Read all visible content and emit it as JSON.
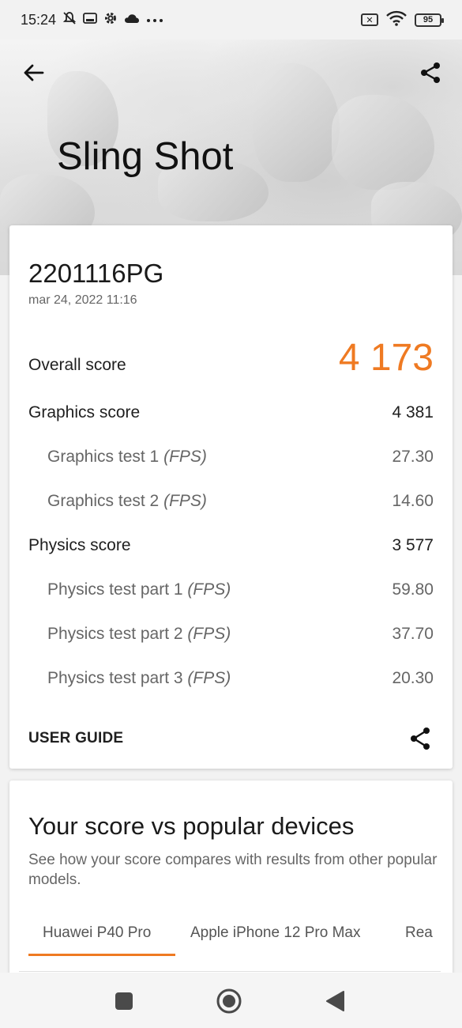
{
  "status_bar": {
    "time": "15:24",
    "battery": "95",
    "icons": [
      "muted-icon",
      "storage-icon",
      "gear-icon",
      "cloud-icon",
      "more-icon",
      "no-sim-icon",
      "wifi-icon",
      "battery-icon"
    ]
  },
  "header": {
    "title": "Sling Shot"
  },
  "result": {
    "device": "2201116PG",
    "date": "mar 24, 2022 11:16",
    "overall": {
      "label": "Overall score",
      "value": "4 173"
    },
    "graphics": {
      "label": "Graphics score",
      "value": "4 381"
    },
    "graphics_test_1": {
      "label": "Graphics test 1",
      "unit": "(FPS)",
      "value": "27.30"
    },
    "graphics_test_2": {
      "label": "Graphics test 2",
      "unit": "(FPS)",
      "value": "14.60"
    },
    "physics": {
      "label": "Physics score",
      "value": "3 577"
    },
    "physics_test_1": {
      "label": "Physics test part 1",
      "unit": "(FPS)",
      "value": "59.80"
    },
    "physics_test_2": {
      "label": "Physics test part 2",
      "unit": "(FPS)",
      "value": "37.70"
    },
    "physics_test_3": {
      "label": "Physics test part 3",
      "unit": "(FPS)",
      "value": "20.30"
    },
    "user_guide": "USER GUIDE"
  },
  "compare": {
    "title": "Your score vs popular devices",
    "description": "See how your score compares with results from other popular models.",
    "tabs": [
      "Huawei P40 Pro",
      "Apple iPhone 12 Pro Max",
      "Rea"
    ],
    "active_tab": "Huawei P40 Pro"
  },
  "colors": {
    "accent": "#ef7a22"
  }
}
